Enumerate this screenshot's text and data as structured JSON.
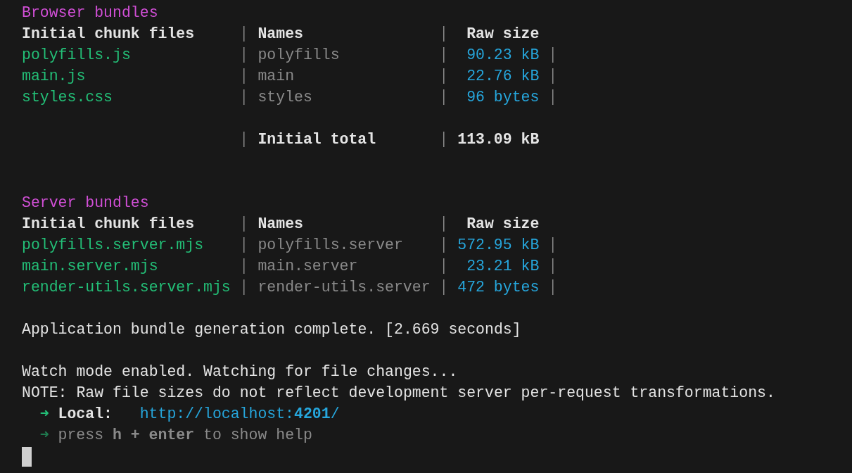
{
  "sections": [
    {
      "title": "Browser bundles",
      "columns": [
        "Initial chunk files",
        "Names",
        "Raw size"
      ],
      "rows": [
        {
          "file": "polyfills.js",
          "name": "polyfills",
          "size": "90.23 kB"
        },
        {
          "file": "main.js",
          "name": "main",
          "size": "22.76 kB"
        },
        {
          "file": "styles.css",
          "name": "styles",
          "size": "96 bytes"
        }
      ],
      "total": {
        "label": "Initial total",
        "value": "113.09 kB"
      }
    },
    {
      "title": "Server bundles",
      "columns": [
        "Initial chunk files",
        "Names",
        "Raw size"
      ],
      "rows": [
        {
          "file": "polyfills.server.mjs",
          "name": "polyfills.server",
          "size": "572.95 kB"
        },
        {
          "file": "main.server.mjs",
          "name": "main.server",
          "size": "23.21 kB"
        },
        {
          "file": "render-utils.server.mjs",
          "name": "render-utils.server",
          "size": "472 bytes"
        }
      ]
    }
  ],
  "build_message": "Application bundle generation complete. [2.669 seconds]",
  "watch_lines": [
    "Watch mode enabled. Watching for file changes...",
    "NOTE: Raw file sizes do not reflect development server per-request transformations."
  ],
  "server_lines": [
    {
      "kind": "link",
      "arrow": "➜",
      "label": "Local:",
      "url": "http://localhost:**4201**/"
    },
    {
      "kind": "hint",
      "arrow": "➜",
      "text": "press **h + enter** to show help"
    }
  ]
}
